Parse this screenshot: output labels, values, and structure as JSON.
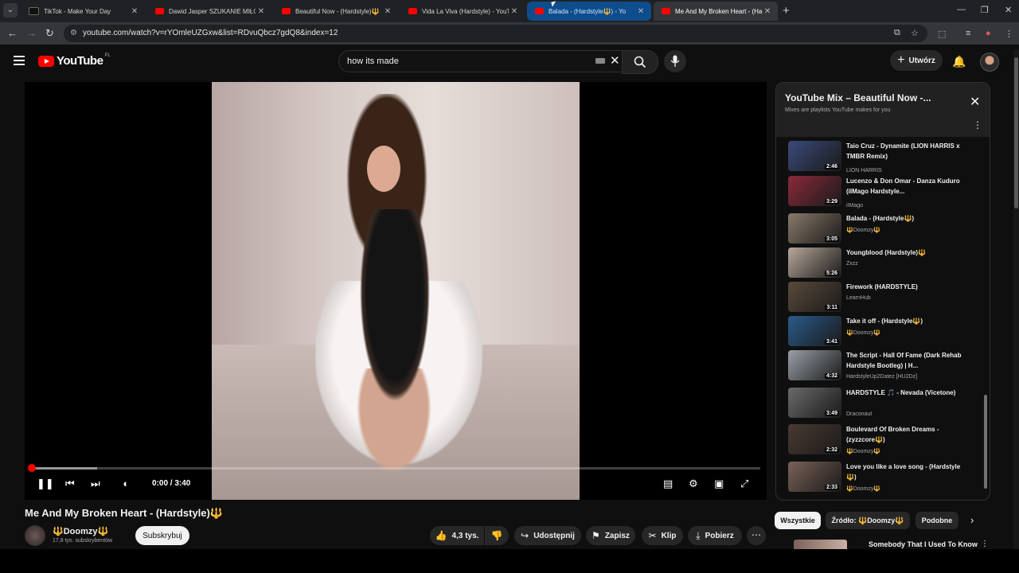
{
  "browser": {
    "tabs": [
      {
        "title": "TikTok - Make Your Day",
        "favicon_color": "#111111",
        "state": "normal"
      },
      {
        "title": "Dawid Jasper SZUKANIE MIŁOŚ",
        "favicon_color": "#ff0000",
        "state": "normal"
      },
      {
        "title": "Beautiful Now - (Hardstyle)🔱",
        "favicon_color": "#ff0000",
        "state": "normal"
      },
      {
        "title": "Vida La Viva (Hardstyle) - YouTu",
        "favicon_color": "#ff0000",
        "state": "normal"
      },
      {
        "title": "Balada - (Hardstyle🔱) - Yo",
        "favicon_color": "#ff0000",
        "state": "highlight"
      },
      {
        "title": "Me And My Broken Heart - (Ha",
        "favicon_color": "#ff0000",
        "state": "active"
      }
    ],
    "url": "youtube.com/watch?v=rYOmleUZGxw&list=RDvuQbcz7gdQ8&index=12"
  },
  "youtube": {
    "logo_text": "YouTube",
    "country_code": "PL",
    "search_query": "how its made",
    "create_label": "Utwórz"
  },
  "player": {
    "time": "0:00 / 3:40",
    "progress_fraction": 0.0,
    "buffered_fraction": 0.09
  },
  "video": {
    "title": "Me And My Broken Heart - (Hardstyle)🔱",
    "channel": "🔱Doomzy🔱",
    "subscribers": "17,8 tys. subskrybentów",
    "subscribe_label": "Subskrybuj",
    "likes": "4,3 tys.",
    "share_label": "Udostępnij",
    "save_label": "Zapisz",
    "clip_label": "Klip",
    "download_label": "Pobierz"
  },
  "playlist": {
    "title": "YouTube Mix – Beautiful Now -...",
    "subtitle": "Mixes are playlists YouTube makes for you",
    "items": [
      {
        "title": "Taio Cruz - Dynamite (LION HARRIS x TMBR Remix)",
        "channel": "LION HARRIS",
        "duration": "2:46",
        "thumb": "#3a4a7a"
      },
      {
        "title": "Lucenzo & Don Omar - Danza Kuduro (iIMago Hardstyle...",
        "channel": "iIMago",
        "duration": "3:29",
        "thumb": "#8a2a3a"
      },
      {
        "title": "Balada - (Hardstyle🔱)",
        "channel": "🔱Doomzy🔱",
        "duration": "3:05",
        "thumb": "#8a7a6a"
      },
      {
        "title": "Youngblood (Hardstyle)🔱",
        "channel": "Zxzz",
        "duration": "5:26",
        "thumb": "#b8a89a"
      },
      {
        "title": "Firework (HARDSTYLE)",
        "channel": "LearnHub",
        "duration": "3:11",
        "thumb": "#5a4a3a"
      },
      {
        "title": "Take it off - (Hardstyle🔱)",
        "channel": "🔱Doomzy🔱",
        "duration": "3:41",
        "thumb": "#2a5a8a"
      },
      {
        "title": "The Script - Hall Of Fame (Dark Rehab Hardstyle Bootleg) | H...",
        "channel": "HardstyleUp2Datez [HU2Dz]",
        "duration": "4:32",
        "thumb": "#9aa0a8"
      },
      {
        "title": "HARDSTYLE 🎵 - Nevada (Vicetone)",
        "channel": "Draconaut",
        "duration": "3:49",
        "thumb": "#6a6a6a"
      },
      {
        "title": "Boulevard Of Broken Dreams - (zyzzcore🔱)",
        "channel": "🔱Doomzy🔱",
        "duration": "2:32",
        "thumb": "#4a3a32"
      },
      {
        "title": "Love you like a love song - (Hardstyle 🔱)",
        "channel": "🔱Doomzy🔱",
        "duration": "2:33",
        "thumb": "#7a6258"
      }
    ]
  },
  "chips": [
    {
      "label": "Wszystkie",
      "selected": true
    },
    {
      "label": "Źródło: 🔱Doomzy🔱",
      "selected": false
    },
    {
      "label": "Podobne",
      "selected": false
    }
  ],
  "next_video": {
    "title": "Somebody That I Used To Know"
  },
  "colors": {
    "accent": "#ff0000",
    "background": "#0f0f0f",
    "surface": "#272727"
  }
}
